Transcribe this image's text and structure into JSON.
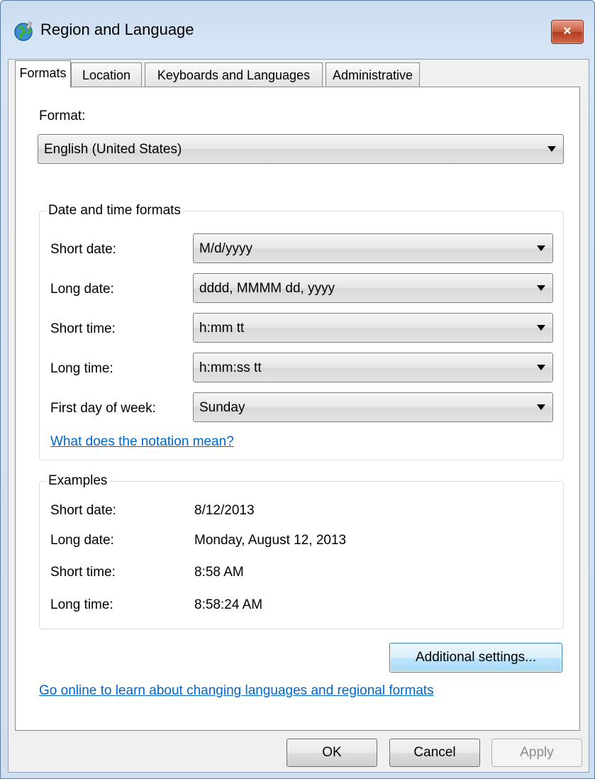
{
  "window": {
    "title": "Region and Language",
    "close_glyph": "×"
  },
  "tabs": [
    {
      "label": "Formats",
      "active": true
    },
    {
      "label": "Location",
      "active": false
    },
    {
      "label": "Keyboards and Languages",
      "active": false
    },
    {
      "label": "Administrative",
      "active": false
    }
  ],
  "format": {
    "label": "Format:",
    "value": "English (United States)"
  },
  "date_time_group": {
    "title": "Date and time formats",
    "rows": [
      {
        "label": "Short date:",
        "value": "M/d/yyyy"
      },
      {
        "label": "Long date:",
        "value": "dddd, MMMM dd, yyyy"
      },
      {
        "label": "Short time:",
        "value": "h:mm tt"
      },
      {
        "label": "Long time:",
        "value": "h:mm:ss tt"
      },
      {
        "label": "First day of week:",
        "value": "Sunday"
      }
    ],
    "notation_link": "What does the notation mean?"
  },
  "examples_group": {
    "title": "Examples",
    "rows": [
      {
        "label": "Short date:",
        "value": "8/12/2013"
      },
      {
        "label": "Long date:",
        "value": "Monday, August 12, 2013"
      },
      {
        "label": "Short time:",
        "value": "8:58 AM"
      },
      {
        "label": "Long time:",
        "value": "8:58:24 AM"
      }
    ]
  },
  "additional_settings_label": "Additional settings...",
  "online_link": "Go online to learn about changing languages and regional formats",
  "buttons": {
    "ok": "OK",
    "cancel": "Cancel",
    "apply": "Apply"
  },
  "icons": {
    "title_icon": "globe-icon",
    "close_icon": "close-icon",
    "dropdown_icon": "chevron-down-icon"
  }
}
